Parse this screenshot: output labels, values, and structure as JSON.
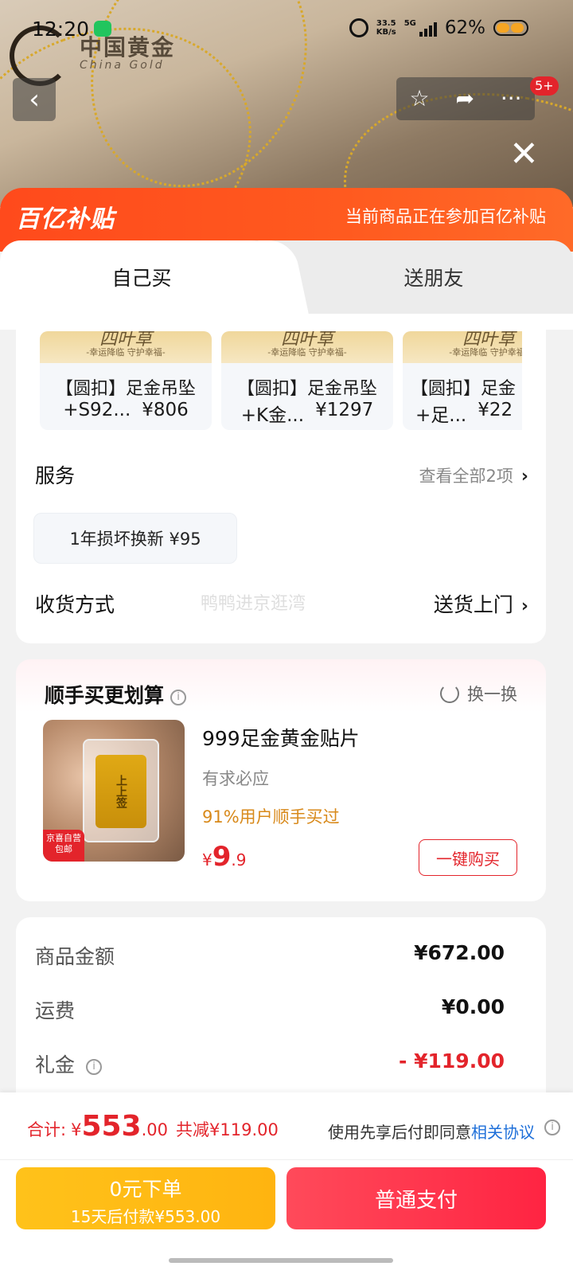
{
  "status_bar": {
    "time": "12:20",
    "net_speed_value": "33.5",
    "net_speed_unit": "KB/s",
    "network": "5G",
    "battery": "62%"
  },
  "brand": {
    "name_cn": "中国黄金",
    "name_en": "China Gold"
  },
  "nav": {
    "back_icon": "‹",
    "star_icon": "☆",
    "share_icon": "➦",
    "more_icon": "···",
    "badge": "5+",
    "close_icon": "✕"
  },
  "banner": {
    "logo": "百亿补贴",
    "text": "当前商品正在参加百亿补贴"
  },
  "tabs": {
    "self": "自己买",
    "gift": "送朋友"
  },
  "variants": [
    {
      "thumb_title": "四叶草",
      "thumb_sub": "-幸运降临 守护幸福-",
      "name": "【圆扣】足金吊坠",
      "line2": "+S92...",
      "price": "¥806"
    },
    {
      "thumb_title": "四叶草",
      "thumb_sub": "-幸运降临 守护幸福-",
      "name": "【圆扣】足金吊坠",
      "line2": "+K金...",
      "price": "¥1297"
    },
    {
      "thumb_title": "四叶草",
      "thumb_sub": "-幸运降临 守护幸福-",
      "name": "【圆扣】足金",
      "line2": "+足...",
      "price": "¥22"
    }
  ],
  "service": {
    "title": "服务",
    "link": "查看全部2项",
    "chip": "1年损坏换新  ¥95"
  },
  "delivery": {
    "title": "收货方式",
    "value": "送货上门",
    "watermark": "鸭鸭进京逛湾"
  },
  "addon": {
    "title": "顺手买更划算",
    "swap": "换一换",
    "product_name": "999足金黄金贴片",
    "subtitle": "有求必应",
    "stat": "91%用户顺手买过",
    "price_currency": "¥",
    "price_int": "9",
    "price_dec": ".9",
    "buy_label": "一键购买",
    "tag": "京喜自营 包邮",
    "plate_text": "上上签"
  },
  "summary": {
    "goods_label": "商品金额",
    "goods_value": "¥672.00",
    "shipping_label": "运费",
    "shipping_value": "¥0.00",
    "gift_label": "礼金",
    "gift_value": "- ¥119.00"
  },
  "bottom": {
    "total_label": "合计:",
    "total_currency": "¥",
    "total_int": "553",
    "total_dec": ".00",
    "total_save": "共减¥119.00",
    "agree_text": "使用先享后付即同意",
    "agree_link": "相关协议",
    "later_line1": "0元下单",
    "later_line2": "15天后付款¥553.00",
    "pay_label": "普通支付"
  },
  "colors": {
    "accent_red": "#e3242b",
    "banner_orange": "#ff5a1f",
    "later_yellow": "#ffb410",
    "link_blue": "#1e6fd9"
  }
}
